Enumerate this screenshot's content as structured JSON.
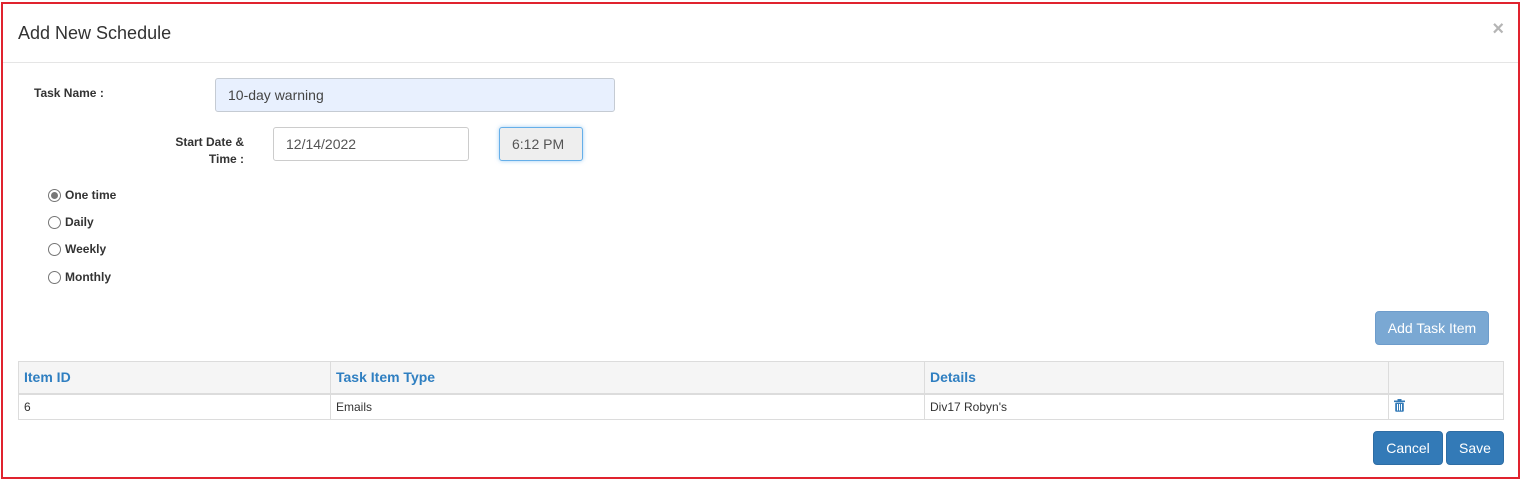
{
  "modal": {
    "title": "Add New Schedule",
    "close_glyph": "×"
  },
  "form": {
    "task_name_label": "Task Name :",
    "task_name_value": "10-day warning",
    "start_label_line1": "Start Date &",
    "start_label_line2": "Time :",
    "start_date_value": "12/14/2022",
    "start_time_value": "6:12 PM"
  },
  "frequency": {
    "selected": "One time",
    "options": [
      "One time",
      "Daily",
      "Weekly",
      "Monthly"
    ]
  },
  "buttons": {
    "add_task_item": "Add Task Item",
    "cancel": "Cancel",
    "save": "Save"
  },
  "table": {
    "columns": [
      "Item ID",
      "Task Item Type",
      "Details",
      ""
    ],
    "rows": [
      {
        "item_id": "6",
        "task_item_type": "Emails",
        "details": "Div17 Robyn's",
        "action_icon": "trash-icon"
      }
    ]
  },
  "colors": {
    "modal_border": "#e0232e",
    "primary": "#337ab7",
    "primary_light": "#7aa8d3",
    "header_link": "#2f7fc1"
  }
}
